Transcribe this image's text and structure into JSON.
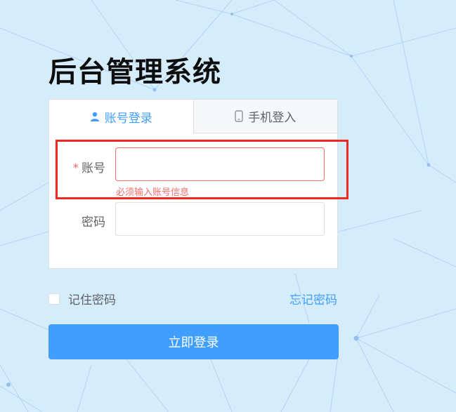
{
  "app": {
    "title": "后台管理系统"
  },
  "tabs": [
    {
      "label": "账号登录",
      "icon": "user-icon",
      "active": true
    },
    {
      "label": "手机登入",
      "icon": "mobile-phone-icon",
      "active": false
    }
  ],
  "form": {
    "account": {
      "label": "账号",
      "required_mark": "*",
      "value": "",
      "error": "必须输入账号信息"
    },
    "password": {
      "label": "密码",
      "value": ""
    }
  },
  "remember": {
    "label": "记住密码",
    "checked": false
  },
  "forgot_link": "忘记密码",
  "login_button": "立即登录",
  "colors": {
    "accent": "#409eff",
    "error": "#f56c6c",
    "background": "#d5ecfb",
    "annotation": "#f02a20"
  }
}
